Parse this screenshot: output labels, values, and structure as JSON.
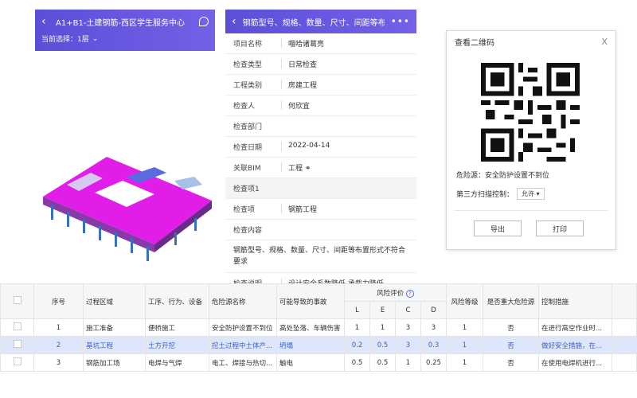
{
  "left_phone": {
    "back_icon": "chevron-left-icon",
    "title": "A1+B1-土建钢筋-西区学生服务中心",
    "location_icon": "location-icon",
    "current_select_label": "当前选择：1层"
  },
  "mid_phone": {
    "title": "钢筋型号、规格、数量、尺寸、间距等布...",
    "more_label": "•••",
    "rows": [
      {
        "label": "项目名称",
        "value": "喵哈诸葛亮"
      },
      {
        "label": "检查类型",
        "value": "日常检查"
      },
      {
        "label": "工程类别",
        "value": "房建工程"
      },
      {
        "label": "检查人",
        "value": "何欣宜"
      },
      {
        "label": "检查部门",
        "value": ""
      },
      {
        "label": "检查日期",
        "value": "2022-04-14"
      },
      {
        "label": "关联BIM",
        "value": "工程"
      },
      {
        "label": "检查项1",
        "value": ""
      },
      {
        "label": "检查项",
        "value": "钢筋工程"
      },
      {
        "label": "检查内容",
        "value": ""
      }
    ],
    "content_text": "钢筋型号、规格、数量、尺寸、间距等布置形式不符合要求",
    "desc_label": "检查说明",
    "desc_value": "设计安全系数降低,承载力降低"
  },
  "dialog": {
    "title": "查看二维码",
    "close_label": "X",
    "hazard_text": "危险源：安全防护设置不到位",
    "perm_label": "第三方扫描控制：",
    "perm_value": "允许",
    "export_label": "导出",
    "print_label": "打印"
  },
  "table": {
    "headers": {
      "seq": "序号",
      "area": "过程区域",
      "process": "工序、行为、设备",
      "hazard": "危险源名称",
      "accident": "可能导致的事故",
      "risk_eval": "风险评价",
      "L": "L",
      "E": "E",
      "C": "C",
      "D": "D",
      "level": "风险等级",
      "major": "是否重大危险源",
      "control": "控制措施"
    },
    "rows": [
      {
        "seq": "1",
        "area": "施工准备",
        "process": "便桥施工",
        "hazard": "安全防护设置不到位",
        "accident": "高处坠落、车辆伤害",
        "L": "1",
        "E": "1",
        "C": "3",
        "D": "3",
        "level": "1",
        "major": "否",
        "control": "在进行高空作业时..."
      },
      {
        "seq": "2",
        "area": "基坑工程",
        "process": "土方开挖",
        "hazard": "挖土过程中土体产...",
        "accident": "坍塌",
        "L": "0.2",
        "E": "0.5",
        "C": "3",
        "D": "0.3",
        "level": "1",
        "major": "否",
        "control": "做好安全措施，在..."
      },
      {
        "seq": "3",
        "area": "钢筋加工场",
        "process": "电焊与气焊",
        "hazard": "电工、焊接与热切...",
        "accident": "触电",
        "L": "0.5",
        "E": "0.5",
        "C": "1",
        "D": "0.25",
        "level": "1",
        "major": "否",
        "control": "在使用电焊机进行..."
      }
    ]
  },
  "colors": {
    "brand": "#5b4fd8",
    "model_magenta": "#e01ee8",
    "selected_row": "#dde6fb"
  }
}
